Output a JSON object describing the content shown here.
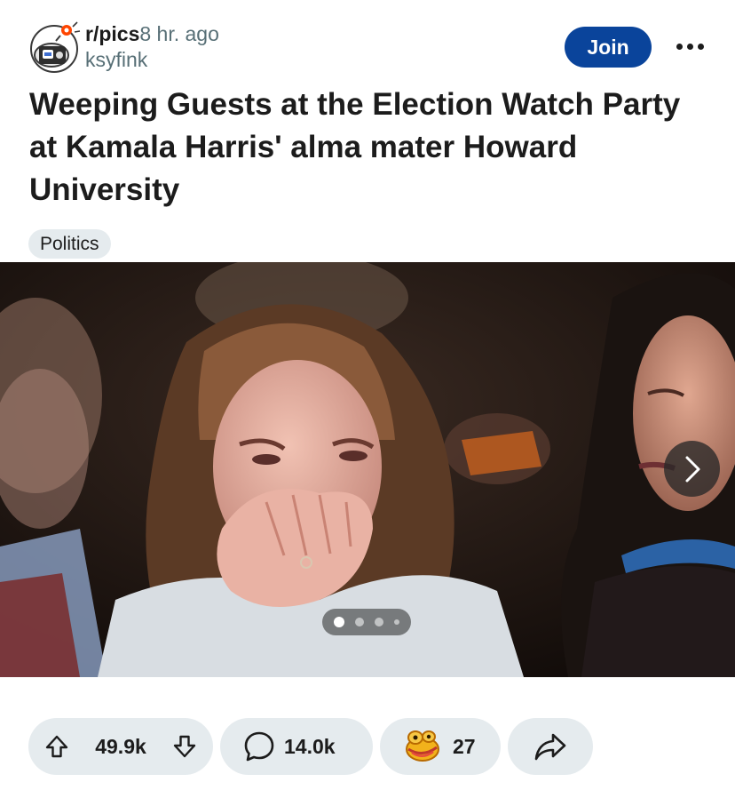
{
  "post": {
    "subreddit": "r/pics",
    "time_ago": "8 hr. ago",
    "author": "ksyfink",
    "join_label": "Join",
    "title": "Weeping Guests at the Election Watch Party at Kamala Harris' alma mater Howard University",
    "flair": "Politics"
  },
  "gallery": {
    "total_images": 4,
    "current_index": 1
  },
  "actions": {
    "upvotes": "49.9k",
    "comments": "14.0k",
    "awards": "27"
  },
  "icons": {
    "avatar": "subreddit-avatar-icon",
    "more": "more-options-icon",
    "next": "chevron-right-icon",
    "upvote": "upvote-arrow-icon",
    "downvote": "downvote-arrow-icon",
    "comment": "comment-bubble-icon",
    "award": "award-icon",
    "share": "share-arrow-icon"
  },
  "colors": {
    "join_button": "#0a449b",
    "pill_background": "#e5ebee",
    "meta_text": "#576f76"
  }
}
